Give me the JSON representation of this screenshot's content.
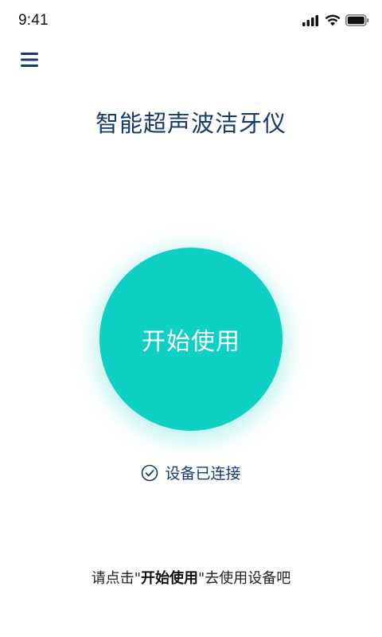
{
  "status_bar": {
    "time": "9:41",
    "icons": [
      "signal-icon",
      "wifi-icon",
      "battery-icon"
    ]
  },
  "menu": {
    "icon": "hamburger-menu-icon"
  },
  "title": "智能超声波洁牙仪",
  "start_button": {
    "label": "开始使用"
  },
  "connection": {
    "icon": "check-circle-icon",
    "text": "设备已连接"
  },
  "hint": {
    "prefix": "请点击\"",
    "emphasis": "开始使用",
    "suffix": "\"去使用设备吧"
  },
  "colors": {
    "accent": "#0fd0c4",
    "primary_text": "#163a6e",
    "background": "#ffffff"
  }
}
